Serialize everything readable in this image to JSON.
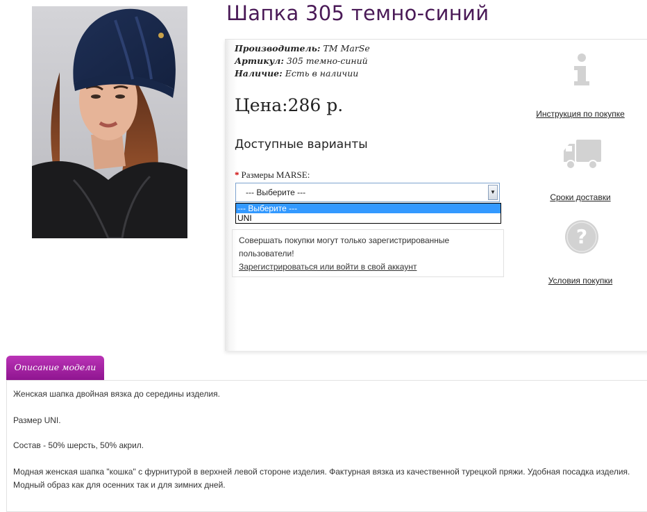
{
  "product": {
    "title": "Шапка 305 темно-синий",
    "image_alt": "Шапка 305 темно-синий",
    "manufacturer_label": "Производитель:",
    "manufacturer_value": "ТМ MarSe",
    "sku_label": "Артикул:",
    "sku_value": "305 темно-синий",
    "availability_label": "Наличие:",
    "availability_value": "Есть в наличии",
    "price": "Цена:286 р."
  },
  "options": {
    "heading": "Доступные варианты",
    "required_mark": "*",
    "size_label": "Размеры MARSE:",
    "select_value": "--- Выберите ---",
    "dropdown_options": [
      "--- Выберите ---",
      "UNI"
    ]
  },
  "notice": {
    "text": "Совершать покупки могут только зарегистрированные пользователи!",
    "link": "Зарегистрироваться или войти в свой аккаунт"
  },
  "sidebar": {
    "instructions_icon": "info-icon",
    "instructions_link": "Инструкция по покупке",
    "delivery_icon": "truck-icon",
    "delivery_link": "Сроки доставки",
    "terms_icon": "question-icon",
    "terms_link": "Условия покупки"
  },
  "description": {
    "tab_label": "Описание модели",
    "p1": "Женская шапка двойная вязка до середины изделия.",
    "p2": "Размер UNI.",
    "p3": "Состав - 50% шерсть, 50% акрил.",
    "p4": "Модная женская шапка \"кошка\" с фурнитурой в верхней левой стороне изделия. Фактурная вязка из качественной турецкой пряжи. Удобная посадка изделия. Модный образ как для осенних так и для зимних дней."
  },
  "colors": {
    "title": "#4a1a57",
    "tab_top": "#ba33b6",
    "tab_bottom": "#8f1590",
    "icon_grey": "#d2d2d2",
    "select_highlight": "#3399ff"
  }
}
